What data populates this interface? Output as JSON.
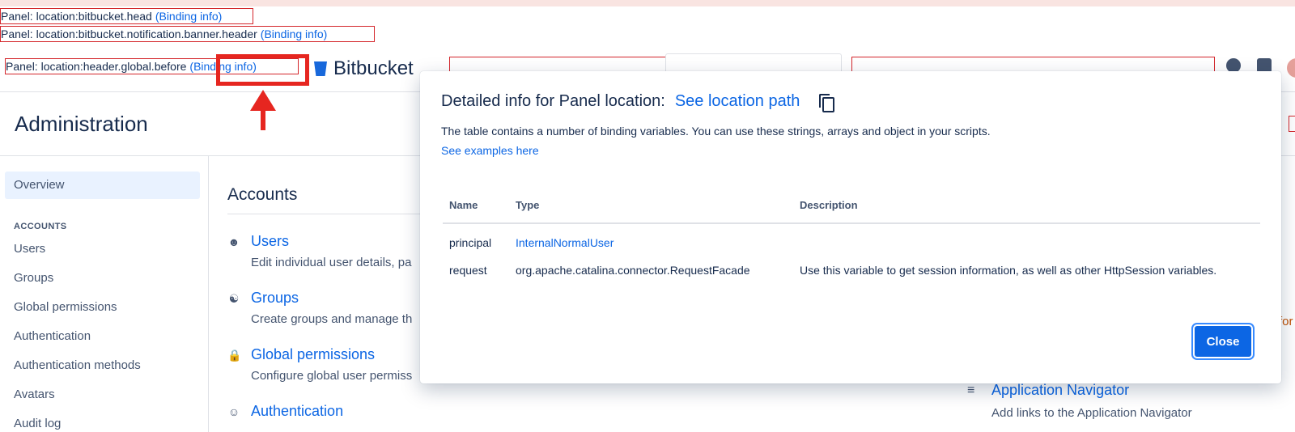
{
  "debug": {
    "panel1": {
      "label": "Panel: location:bitbucket.head",
      "binding": "(Binding info)"
    },
    "panel2": {
      "label": "Panel: location:bitbucket.notification.banner.header",
      "binding": "(Binding info)"
    },
    "panel3": {
      "label": "Panel: location:header.global.before",
      "binding": "(Binding info)"
    }
  },
  "header": {
    "product": "Bitbucket"
  },
  "admin": {
    "title": "Administration",
    "sidebar": {
      "overview": "Overview",
      "accounts_heading": "ACCOUNTS",
      "items": [
        "Users",
        "Groups",
        "Global permissions",
        "Authentication",
        "Authentication methods",
        "Avatars",
        "Audit log"
      ]
    },
    "accounts": {
      "title": "Accounts",
      "items": [
        {
          "title": "Users",
          "desc": "Edit individual user details, pa",
          "icon": "user-icon"
        },
        {
          "title": "Groups",
          "desc": "Create groups and manage th",
          "icon": "groups-icon"
        },
        {
          "title": "Global permissions",
          "desc": "Configure global user permiss",
          "icon": "lock-icon"
        },
        {
          "title": "Authentication",
          "desc": "",
          "icon": "user-circle-icon"
        }
      ]
    },
    "app_nav": {
      "title": "Application Navigator",
      "desc": "Add links to the Application Navigator"
    },
    "edge_text": "for"
  },
  "modal": {
    "title": "Detailed info for Panel location:",
    "location_link": "See location path",
    "description": "The table contains a number of binding variables. You can use these strings, arrays and object in your scripts.",
    "examples_link": "See examples here",
    "columns": [
      "Name",
      "Type",
      "Description"
    ],
    "rows": [
      {
        "name": "principal",
        "type": "InternalNormalUser",
        "description": ""
      },
      {
        "name": "request",
        "type": "org.apache.catalina.connector.RequestFacade",
        "description": "Use this variable to get session information, as well as other HttpSession variables."
      }
    ],
    "close_label": "Close"
  },
  "colors": {
    "accent": "#0c66e4",
    "annotation": "#e62620",
    "debug_border": "#d4262b"
  }
}
